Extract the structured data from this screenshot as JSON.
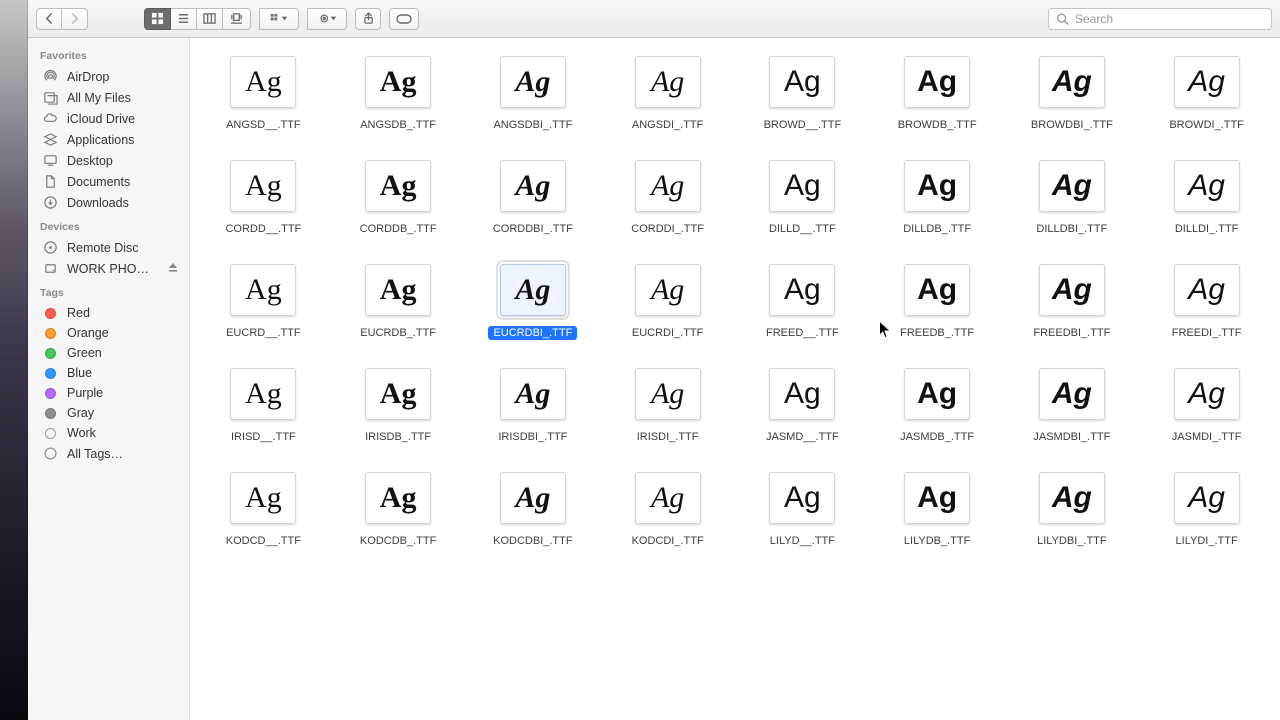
{
  "search": {
    "placeholder": "Search"
  },
  "sidebar": {
    "favorites_header": "Favorites",
    "favorites": [
      {
        "label": "AirDrop",
        "icon": "airdrop"
      },
      {
        "label": "All My Files",
        "icon": "allfiles"
      },
      {
        "label": "iCloud Drive",
        "icon": "icloud"
      },
      {
        "label": "Applications",
        "icon": "apps"
      },
      {
        "label": "Desktop",
        "icon": "desktop"
      },
      {
        "label": "Documents",
        "icon": "documents"
      },
      {
        "label": "Downloads",
        "icon": "downloads"
      }
    ],
    "devices_header": "Devices",
    "devices": [
      {
        "label": "Remote Disc",
        "icon": "remotedisc",
        "eject": false
      },
      {
        "label": "WORK PHO…",
        "icon": "workdrive",
        "eject": true
      }
    ],
    "tags_header": "Tags",
    "tags": [
      {
        "label": "Red",
        "color": "#ff5b4f"
      },
      {
        "label": "Orange",
        "color": "#ff9b2e"
      },
      {
        "label": "Green",
        "color": "#41c658"
      },
      {
        "label": "Blue",
        "color": "#2f95ff"
      },
      {
        "label": "Purple",
        "color": "#b367ff"
      },
      {
        "label": "Gray",
        "color": "#8e8e8e"
      },
      {
        "label": "Work",
        "color": "transparent"
      }
    ],
    "all_tags_label": "All Tags…"
  },
  "selected_index": 18,
  "files": [
    {
      "name": "ANGSD__.TTF",
      "preview": "Ag",
      "style": "serif"
    },
    {
      "name": "ANGSDB_.TTF",
      "preview": "Ag",
      "style": "serif-bold"
    },
    {
      "name": "ANGSDBI_.TTF",
      "preview": "Ag",
      "style": "serif-bold-italic"
    },
    {
      "name": "ANGSDI_.TTF",
      "preview": "Ag",
      "style": "serif-italic"
    },
    {
      "name": "BROWD__.TTF",
      "preview": "Ag",
      "style": "sans"
    },
    {
      "name": "BROWDB_.TTF",
      "preview": "Ag",
      "style": "sans-bold"
    },
    {
      "name": "BROWDBI_.TTF",
      "preview": "Ag",
      "style": "sans-bold-italic"
    },
    {
      "name": "BROWDI_.TTF",
      "preview": "Ag",
      "style": "sans-italic"
    },
    {
      "name": "CORDD__.TTF",
      "preview": "Ag",
      "style": "serif"
    },
    {
      "name": "CORDDB_.TTF",
      "preview": "Ag",
      "style": "serif-bold"
    },
    {
      "name": "CORDDBI_.TTF",
      "preview": "Ag",
      "style": "serif-bold-italic"
    },
    {
      "name": "CORDDI_.TTF",
      "preview": "Ag",
      "style": "serif-italic"
    },
    {
      "name": "DILLD__.TTF",
      "preview": "Ag",
      "style": "sans"
    },
    {
      "name": "DILLDB_.TTF",
      "preview": "Ag",
      "style": "sans-bold"
    },
    {
      "name": "DILLDBI_.TTF",
      "preview": "Ag",
      "style": "sans-bold-italic"
    },
    {
      "name": "DILLDI_.TTF",
      "preview": "Ag",
      "style": "sans-italic"
    },
    {
      "name": "EUCRD__.TTF",
      "preview": "Ag",
      "style": "serif"
    },
    {
      "name": "EUCRDB_.TTF",
      "preview": "Ag",
      "style": "serif-bold"
    },
    {
      "name": "EUCRDBI_.TTF",
      "preview": "Ag",
      "style": "serif-bold-italic"
    },
    {
      "name": "EUCRDI_.TTF",
      "preview": "Ag",
      "style": "serif-italic"
    },
    {
      "name": "FREED__.TTF",
      "preview": "Ag",
      "style": "sans"
    },
    {
      "name": "FREEDB_.TTF",
      "preview": "Ag",
      "style": "sans-bold"
    },
    {
      "name": "FREEDBI_.TTF",
      "preview": "Ag",
      "style": "sans-bold-italic"
    },
    {
      "name": "FREEDI_.TTF",
      "preview": "Ag",
      "style": "sans-italic"
    },
    {
      "name": "IRISD__.TTF",
      "preview": "Ag",
      "style": "serif"
    },
    {
      "name": "IRISDB_.TTF",
      "preview": "Ag",
      "style": "serif-bold"
    },
    {
      "name": "IRISDBI_.TTF",
      "preview": "Ag",
      "style": "serif-bold-italic"
    },
    {
      "name": "IRISDI_.TTF",
      "preview": "Ag",
      "style": "serif-italic"
    },
    {
      "name": "JASMD__.TTF",
      "preview": "Ag",
      "style": "sans"
    },
    {
      "name": "JASMDB_.TTF",
      "preview": "Ag",
      "style": "sans-bold"
    },
    {
      "name": "JASMDBI_.TTF",
      "preview": "Ag",
      "style": "sans-bold-italic"
    },
    {
      "name": "JASMDI_.TTF",
      "preview": "Ag",
      "style": "sans-italic"
    },
    {
      "name": "KODCD__.TTF",
      "preview": "Ag",
      "style": "serif"
    },
    {
      "name": "KODCDB_.TTF",
      "preview": "Ag",
      "style": "serif-bold"
    },
    {
      "name": "KODCDBI_.TTF",
      "preview": "Ag",
      "style": "serif-bold-italic"
    },
    {
      "name": "KODCDI_.TTF",
      "preview": "Ag",
      "style": "serif-italic"
    },
    {
      "name": "LILYD__.TTF",
      "preview": "Ag",
      "style": "sans"
    },
    {
      "name": "LILYDB_.TTF",
      "preview": "Ag",
      "style": "sans-bold"
    },
    {
      "name": "LILYDBI_.TTF",
      "preview": "Ag",
      "style": "sans-bold-italic"
    },
    {
      "name": "LILYDI_.TTF",
      "preview": "Ag",
      "style": "sans-italic"
    }
  ]
}
